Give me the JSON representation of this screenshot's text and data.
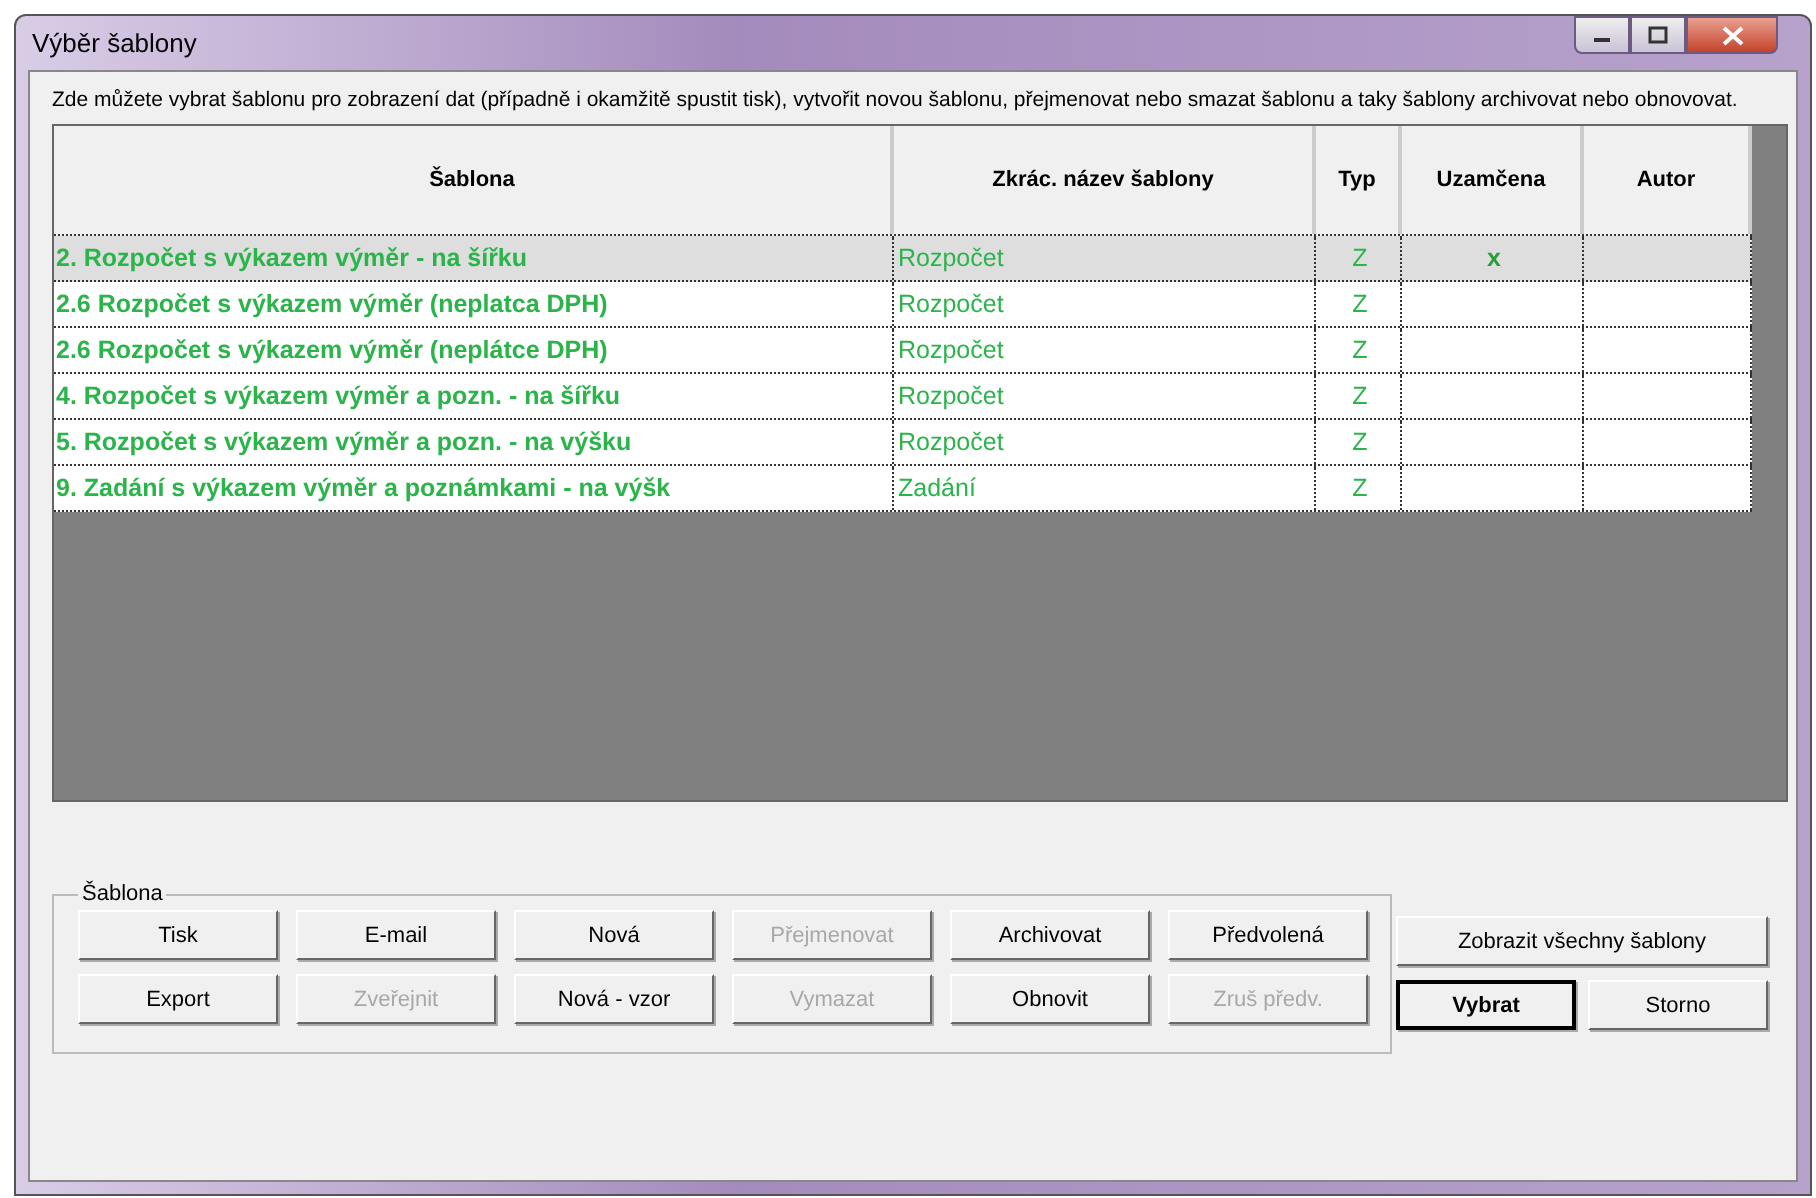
{
  "window": {
    "title": "Výběr šablony"
  },
  "description": "Zde můžete vybrat šablonu pro zobrazení dat (případně i okamžitě spustit tisk), vytvořit novou šablonu, přejmenovat nebo smazat šablonu a taky šablony archivovat nebo obnovovat.",
  "table": {
    "columns": [
      "Šablona",
      "Zkrác. název šablony",
      "Typ",
      "Uzamčena",
      "Autor"
    ],
    "rows": [
      {
        "name": "2. Rozpočet s výkazem výměr - na šířku",
        "short": "Rozpočet",
        "type": "Z",
        "locked": "x",
        "selected": true
      },
      {
        "name": "2.6 Rozpočet s výkazem výměr (neplatca DPH)",
        "short": "Rozpočet",
        "type": "Z",
        "selected": false
      },
      {
        "name": "2.6 Rozpočet s výkazem výměr (neplátce DPH)",
        "short": "Rozpočet",
        "type": "Z",
        "selected": false
      },
      {
        "name": "4. Rozpočet s výkazem výměr a pozn. - na šířku",
        "short": "Rozpočet",
        "type": "Z",
        "selected": false
      },
      {
        "name": "5. Rozpočet s výkazem výměr a pozn. - na výšku",
        "short": "Rozpočet",
        "type": "Z",
        "selected": false
      },
      {
        "name": "9. Zadání s výkazem výměr a poznámkami - na výšk",
        "short": "Zadání",
        "type": "Z",
        "selected": false
      }
    ]
  },
  "group": {
    "title": "Šablona",
    "buttons": [
      {
        "label": "Tisk",
        "disabled": false
      },
      {
        "label": "E-mail",
        "disabled": false
      },
      {
        "label": "Nová",
        "disabled": false
      },
      {
        "label": "Přejmenovat",
        "disabled": true
      },
      {
        "label": "Archivovat",
        "disabled": false
      },
      {
        "label": "Předvolená",
        "disabled": false
      },
      {
        "label": "Export",
        "disabled": false
      },
      {
        "label": "Zveřejnit",
        "disabled": true
      },
      {
        "label": "Nová - vzor",
        "disabled": false
      },
      {
        "label": "Vymazat",
        "disabled": true
      },
      {
        "label": "Obnovit",
        "disabled": false
      },
      {
        "label": "Zruš předv.",
        "disabled": true
      }
    ]
  },
  "side_buttons": [
    {
      "label": "Zobrazit všechny šablony",
      "default": false,
      "wide": true
    },
    {
      "label": "Vybrat",
      "default": true,
      "wide": false
    },
    {
      "label": "Storno",
      "default": false,
      "wide": false
    }
  ]
}
